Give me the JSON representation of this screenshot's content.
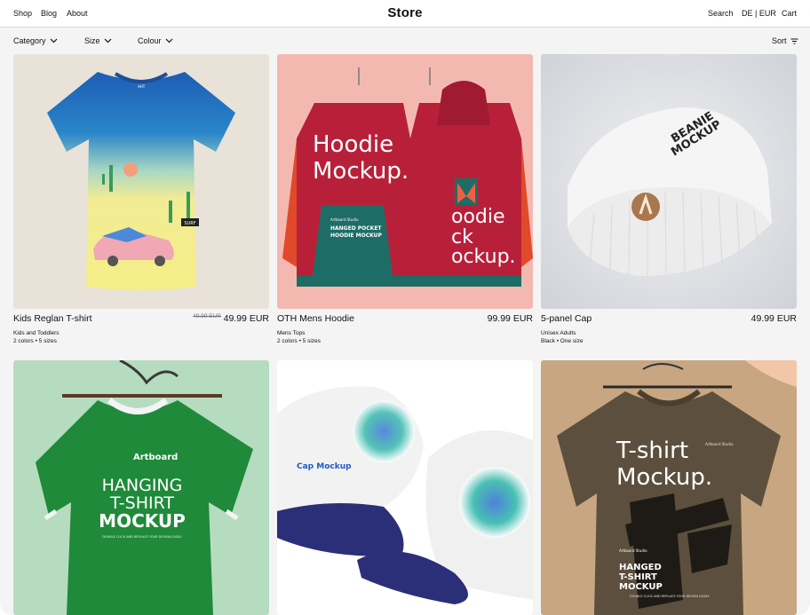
{
  "header": {
    "nav": [
      {
        "label": "Shop"
      },
      {
        "label": "Blog"
      },
      {
        "label": "About"
      }
    ],
    "title": "Store",
    "search_label": "Search",
    "lang_label": "DE | EUR",
    "cart_label": "Cart"
  },
  "filters": {
    "category": "Category",
    "size": "Size",
    "colour": "Colour",
    "sort": "Sort"
  },
  "products": [
    {
      "name": "Kids Reglan T-shirt",
      "old_price": "49.99 EUR",
      "price": "49.99 EUR",
      "category": "Kids and Toddlers",
      "meta": "2 colors • 5 sizes",
      "image_text": {
        "neck_tag": "HHT",
        "sign": "SURF"
      }
    },
    {
      "name": "OTH Mens Hoodie",
      "price": "99.99 EUR",
      "category": "Mens Tops",
      "meta": "2 colors • 5 sizes",
      "image_text": {
        "line1": "Hoodie",
        "line2": "Mockup.",
        "back1": "oodie",
        "back2": "ck",
        "back3": "ockup.",
        "pocket_brand": "Artboard Studio",
        "pocket_title1": "HANGED POCKET",
        "pocket_title2": "HOODIE MOCKUP"
      }
    },
    {
      "name": "5-panel Cap",
      "price": "49.99 EUR",
      "category": "Unisex Adults",
      "meta": "Black • One size",
      "image_text": {
        "line1": "BEANIE",
        "line2": "MOCKUP"
      }
    },
    {
      "name": "",
      "price": "",
      "category": "",
      "meta": "",
      "image_text": {
        "brand": "Artboard",
        "line1": "HANGING",
        "line2": "T-SHIRT",
        "line3": "MOCKUP",
        "small": "DOUBLE CLICK AND REPLACE YOUR DESIGN EASILY"
      }
    },
    {
      "name": "",
      "price": "",
      "category": "",
      "meta": "",
      "image_text": {
        "label": "Cap Mockup"
      }
    },
    {
      "name": "",
      "price": "",
      "category": "",
      "meta": "",
      "image_text": {
        "line1": "T-shirt",
        "line2": "Mockup.",
        "brand": "Artboard Studio",
        "studio": "Artboard Studio",
        "title1": "HANGED",
        "title2": "T-SHIRT",
        "title3": "MOCKUP",
        "small": "DOUBLE CLICK AND REPLACE YOUR DESIGN EASILY"
      }
    }
  ],
  "colors": {
    "background": "#f4f4f5",
    "header_bg": "#ffffff",
    "text": "#111111",
    "hoodie_red": "#b8203a",
    "tee_green": "#1f8a3a",
    "tee_brown": "#5c4f3d"
  }
}
